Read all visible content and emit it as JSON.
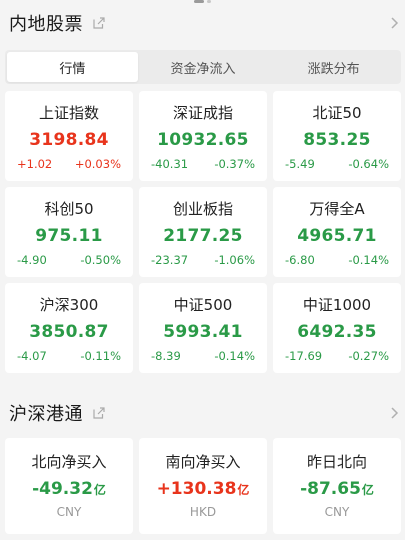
{
  "colors": {
    "up": "#e8341c",
    "down": "#2a9a47",
    "background": "#f4f4f4"
  },
  "mainland": {
    "title": "内地股票",
    "tabs": [
      {
        "label": "行情",
        "active": true
      },
      {
        "label": "资金净流入",
        "active": false
      },
      {
        "label": "涨跌分布",
        "active": false
      }
    ],
    "indices": [
      {
        "name": "上证指数",
        "value": "3198.84",
        "change": "+1.02",
        "pct": "+0.03%",
        "direction": "up"
      },
      {
        "name": "深证成指",
        "value": "10932.65",
        "change": "-40.31",
        "pct": "-0.37%",
        "direction": "down"
      },
      {
        "name": "北证50",
        "value": "853.25",
        "change": "-5.49",
        "pct": "-0.64%",
        "direction": "down"
      },
      {
        "name": "科创50",
        "value": "975.11",
        "change": "-4.90",
        "pct": "-0.50%",
        "direction": "down"
      },
      {
        "name": "创业板指",
        "value": "2177.25",
        "change": "-23.37",
        "pct": "-1.06%",
        "direction": "down"
      },
      {
        "name": "万得全A",
        "value": "4965.71",
        "change": "-6.80",
        "pct": "-0.14%",
        "direction": "down"
      },
      {
        "name": "沪深300",
        "value": "3850.87",
        "change": "-4.07",
        "pct": "-0.11%",
        "direction": "down"
      },
      {
        "name": "中证500",
        "value": "5993.41",
        "change": "-8.39",
        "pct": "-0.14%",
        "direction": "down"
      },
      {
        "name": "中证1000",
        "value": "6492.35",
        "change": "-17.69",
        "pct": "-0.27%",
        "direction": "down"
      }
    ]
  },
  "connect": {
    "title": "沪深港通",
    "cards": [
      {
        "name": "北向净买入",
        "value": "-49.32",
        "unit": "亿",
        "currency": "CNY",
        "direction": "down"
      },
      {
        "name": "南向净买入",
        "value": "+130.38",
        "unit": "亿",
        "currency": "HKD",
        "direction": "up"
      },
      {
        "name": "昨日北向",
        "value": "-87.65",
        "unit": "亿",
        "currency": "CNY",
        "direction": "down"
      }
    ]
  },
  "icons": {
    "external": "external-link-icon",
    "chevron": "chevron-right-icon"
  }
}
